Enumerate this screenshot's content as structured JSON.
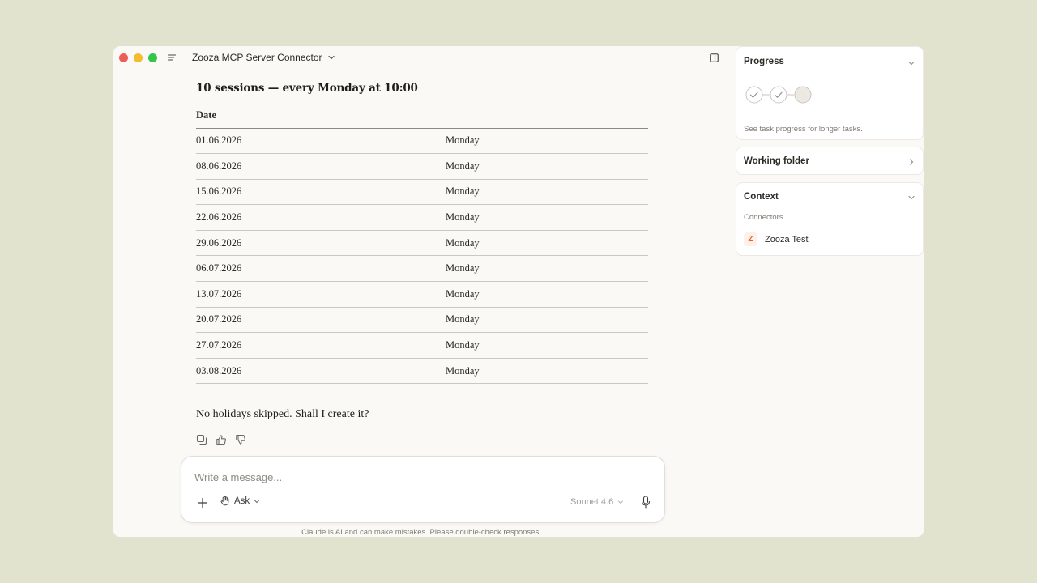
{
  "titlebar": {
    "conversation_title": "Zooza MCP Server Connector"
  },
  "message": {
    "heading": "10 sessions — every Monday at 10:00",
    "table": {
      "headers": [
        "Date",
        ""
      ],
      "rows": [
        [
          "01.06.2026",
          "Monday"
        ],
        [
          "08.06.2026",
          "Monday"
        ],
        [
          "15.06.2026",
          "Monday"
        ],
        [
          "22.06.2026",
          "Monday"
        ],
        [
          "29.06.2026",
          "Monday"
        ],
        [
          "06.07.2026",
          "Monday"
        ],
        [
          "13.07.2026",
          "Monday"
        ],
        [
          "20.07.2026",
          "Monday"
        ],
        [
          "27.07.2026",
          "Monday"
        ],
        [
          "03.08.2026",
          "Monday"
        ]
      ]
    },
    "closing": "No holidays skipped. Shall I create it?"
  },
  "composer": {
    "placeholder": "Write a message...",
    "mode_label": "Ask",
    "model_label": "Sonnet 4.6"
  },
  "disclaimer": "Claude is AI and can make mistakes. Please double-check responses.",
  "sidebar": {
    "progress": {
      "title": "Progress",
      "steps": [
        "done",
        "done",
        "pending"
      ],
      "hint": "See task progress for longer tasks."
    },
    "working_folder": {
      "title": "Working folder"
    },
    "context": {
      "title": "Context",
      "connectors_label": "Connectors",
      "connectors": [
        {
          "logo_letter": "Z",
          "name": "Zooza Test"
        }
      ]
    }
  },
  "colors": {
    "page_background": "#e1e3cf",
    "window_background": "#faf9f6",
    "connector_accent": "#e8662a",
    "traffic_red": "#ec5f57",
    "traffic_yellow": "#f4bd2f",
    "traffic_green": "#35c649"
  },
  "icons": {
    "titlebar": [
      "menu-icon",
      "chevron-down-icon",
      "sidebar-toggle-icon"
    ],
    "message_actions": [
      "copy-icon",
      "thumbs-up-icon",
      "thumbs-down-icon"
    ],
    "composer": [
      "plus-icon",
      "hand-icon",
      "chevron-down-icon",
      "microphone-icon"
    ]
  }
}
